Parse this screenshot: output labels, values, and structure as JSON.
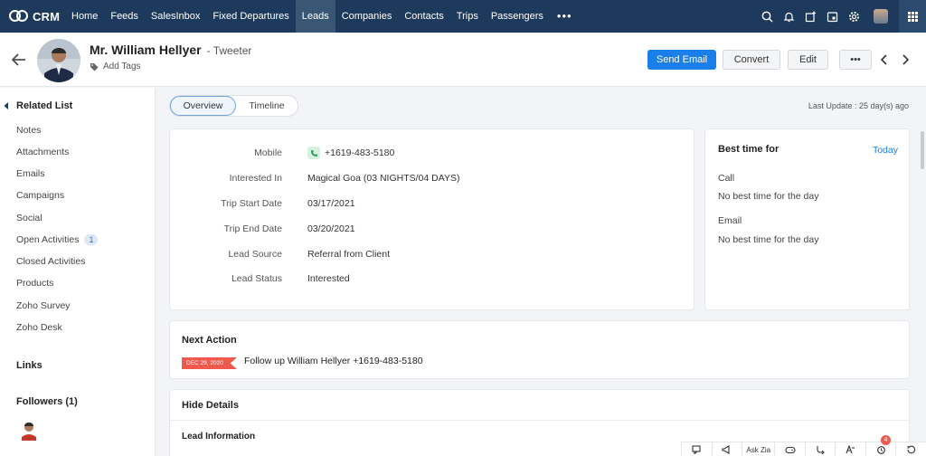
{
  "app": {
    "name": "CRM"
  },
  "nav": {
    "items": [
      {
        "label": "Home"
      },
      {
        "label": "Feeds"
      },
      {
        "label": "SalesInbox"
      },
      {
        "label": "Fixed Departures"
      },
      {
        "label": "Leads",
        "active": true
      },
      {
        "label": "Companies"
      },
      {
        "label": "Contacts"
      },
      {
        "label": "Trips"
      },
      {
        "label": "Passengers"
      }
    ],
    "more": "•••"
  },
  "record": {
    "name": "Mr. William Hellyer",
    "source_tag": "- Tweeter",
    "add_tags": "Add Tags"
  },
  "actions": {
    "send_email": "Send Email",
    "convert": "Convert",
    "edit": "Edit",
    "more": "•••"
  },
  "sidebar": {
    "related_title": "Related List",
    "items": [
      {
        "label": "Notes"
      },
      {
        "label": "Attachments"
      },
      {
        "label": "Emails"
      },
      {
        "label": "Campaigns"
      },
      {
        "label": "Social"
      },
      {
        "label": "Open Activities",
        "badge": "1"
      },
      {
        "label": "Closed Activities"
      },
      {
        "label": "Products"
      },
      {
        "label": "Zoho Survey"
      },
      {
        "label": "Zoho Desk"
      }
    ],
    "links_title": "Links",
    "followers_title": "Followers (1)"
  },
  "tabs": {
    "overview": "Overview",
    "timeline": "Timeline"
  },
  "last_update": "Last Update : 25 day(s) ago",
  "details": [
    {
      "label": "Mobile",
      "value": "+1619-483-5180"
    },
    {
      "label": "Interested In",
      "value": "Magical Goa (03 NIGHTS/04 DAYS)"
    },
    {
      "label": "Trip Start Date",
      "value": "03/17/2021"
    },
    {
      "label": "Trip End Date",
      "value": "03/20/2021"
    },
    {
      "label": "Lead Source",
      "value": "Referral from Client"
    },
    {
      "label": "Lead Status",
      "value": "Interested"
    }
  ],
  "best_time": {
    "title": "Best time for",
    "today": "Today",
    "call_label": "Call",
    "call_value": "No best time for the day",
    "email_label": "Email",
    "email_value": "No best time for the day"
  },
  "next_action": {
    "title": "Next Action",
    "date": "DEC 29, 2020",
    "text": "Follow up William Hellyer +1619-483-5180"
  },
  "hide_details": {
    "title": "Hide Details",
    "section": "Lead Information"
  },
  "bottom_bar": {
    "ask_zia": "Ask Zia",
    "reminder_count": "4"
  },
  "colors": {
    "nav_bg": "#1d3a5c",
    "primary": "#1a7fe8",
    "date_flag": "#ef5a4c"
  }
}
